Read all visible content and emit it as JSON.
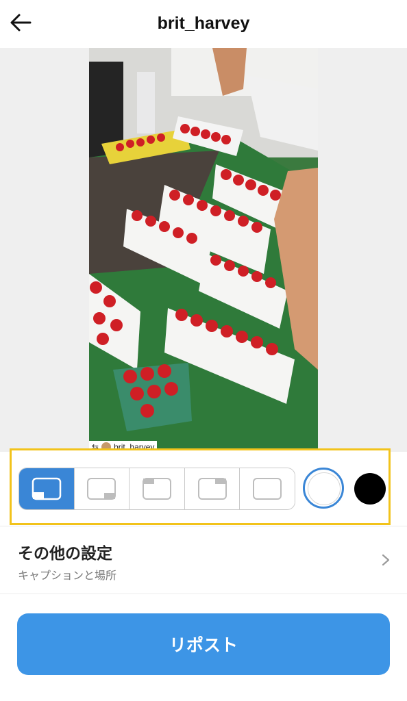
{
  "header": {
    "title": "brit_harvey",
    "back_icon": "arrow-left-icon"
  },
  "preview": {
    "credit_name": "brit_harvey",
    "credit_icon": "repost-icon"
  },
  "style_options": [
    {
      "icon": "layout-bottom-left-icon",
      "selected": true
    },
    {
      "icon": "layout-bottom-right-icon",
      "selected": false
    },
    {
      "icon": "layout-top-left-icon",
      "selected": false
    },
    {
      "icon": "layout-top-right-icon",
      "selected": false
    },
    {
      "icon": "layout-none-icon",
      "selected": false
    }
  ],
  "colors": {
    "accent": "#3a86d6",
    "highlight": "#f2c31b",
    "button": "#3d95e6",
    "white_option": "#ffffff",
    "black_option": "#000000",
    "white_selected": true
  },
  "settings": {
    "title": "その他の設定",
    "subtitle": "キャプションと場所",
    "chevron_icon": "chevron-right-icon"
  },
  "repost": {
    "label": "リポスト"
  }
}
